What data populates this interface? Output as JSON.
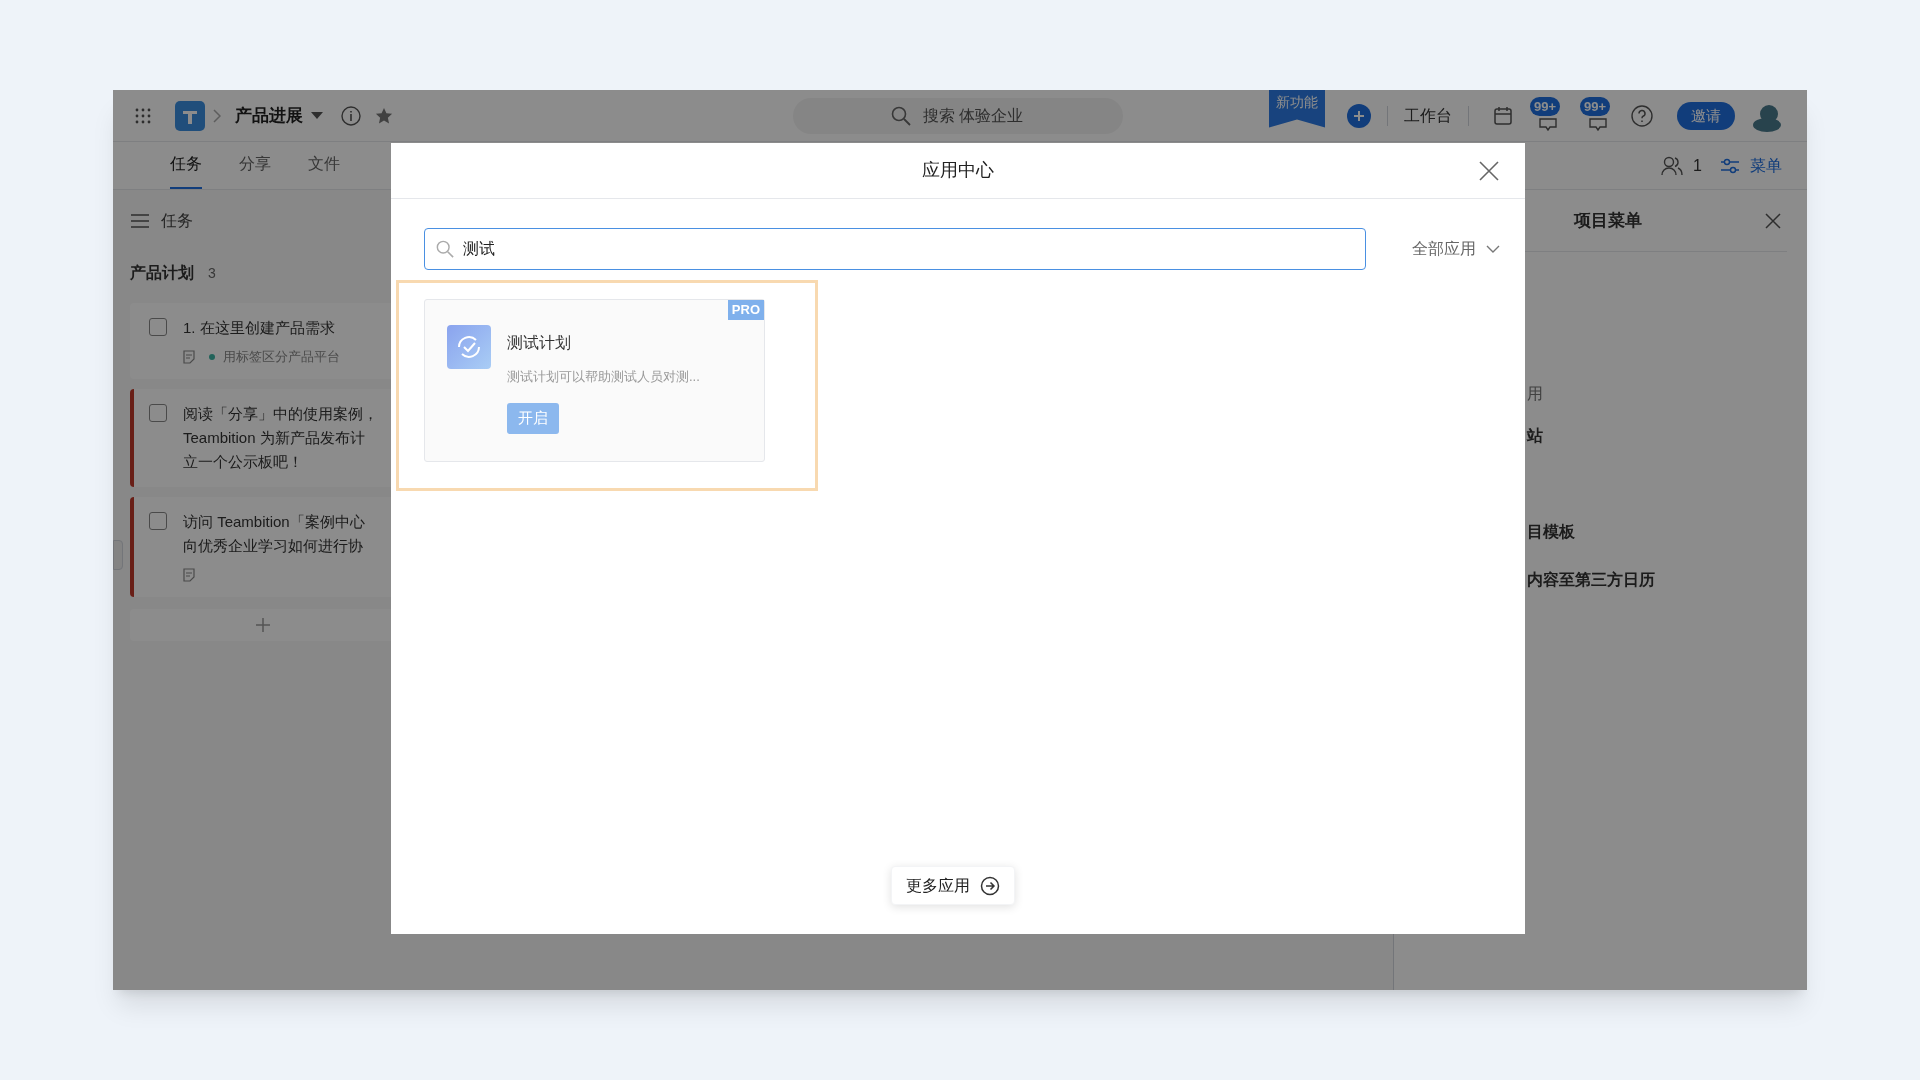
{
  "topbar": {
    "project": "产品进展",
    "search_placeholder": "搜索 体验企业",
    "new_feature": "新功能",
    "workbench": "工作台",
    "badges": [
      "99+",
      "99+"
    ],
    "invite": "邀请"
  },
  "tabs": [
    {
      "label": "任务",
      "selected": true
    },
    {
      "label": "分享",
      "selected": false
    },
    {
      "label": "文件",
      "selected": false
    }
  ],
  "members_count": "1",
  "menu_label": "菜单",
  "task_panel": {
    "title": "任务",
    "list_name": "产品计划",
    "list_count": "3",
    "tasks": [
      {
        "lines": [
          "1. 在这里创建产品需求"
        ],
        "checked": false,
        "flagged": false,
        "has_note": true,
        "tag": {
          "label": "用标签区分产品平台"
        }
      },
      {
        "lines": [
          "阅读「分享」中的使用案例，",
          "Teambition 为新产品发布计",
          "立一个公示板吧！"
        ],
        "checked": false,
        "flagged": true,
        "has_note": false
      },
      {
        "lines": [
          "访问 Teambition「案例中心",
          "向优秀企业学习如何进行协"
        ],
        "checked": false,
        "flagged": true,
        "has_note": true
      }
    ]
  },
  "side_menu": {
    "title": "项目菜单",
    "items": [
      "用",
      "站",
      "目模板",
      "内容至第三方日历"
    ]
  },
  "dialog": {
    "title": "应用中心",
    "search_value": "测试",
    "filter": "全部应用",
    "apps": [
      {
        "name": "测试计划",
        "description": "测试计划可以帮助测试人员对测...",
        "badge": "PRO",
        "action": "开启",
        "highlighted": true
      }
    ],
    "more": "更多应用"
  }
}
